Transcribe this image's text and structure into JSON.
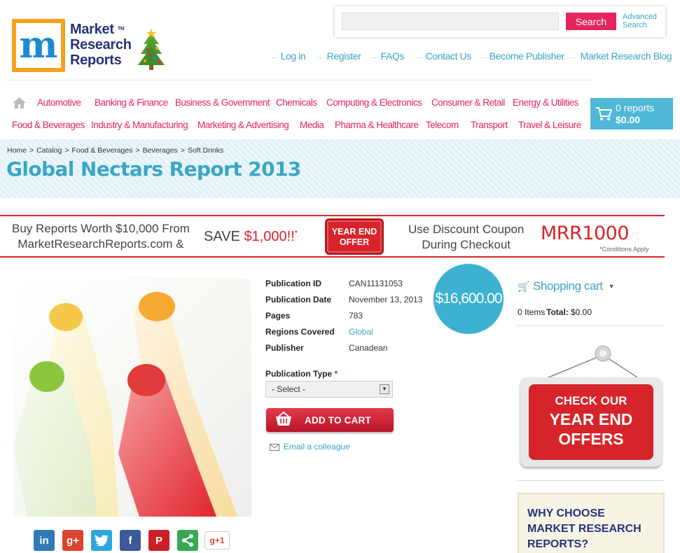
{
  "header": {
    "logo": {
      "line1": "Market",
      "line2": "Research",
      "line3": "Reports",
      "tm": "TM"
    },
    "search": {
      "placeholder": "",
      "button": "Search",
      "advanced": "Advanced Search"
    },
    "toplinks": [
      "Log in",
      "Register",
      "FAQs",
      "Contact Us",
      "Become Publisher",
      "Market Research Blog"
    ]
  },
  "nav": {
    "row1": [
      "Automotive",
      "Banking & Finance",
      "Business & Government",
      "Chemicals",
      "Computing & Electronics",
      "Consumer & Retail",
      "Energy & Utilities"
    ],
    "row2": [
      "Food & Beverages",
      "Industry & Manufacturing",
      "Marketing & Advertising",
      "Media",
      "Pharma & Healthcare",
      "Telecom",
      "Transport",
      "Travel & Leisure"
    ]
  },
  "cart_widget": {
    "count": "0 reports",
    "total": "$0.00"
  },
  "breadcrumb": [
    "Home",
    "Catalog",
    "Food & Beverages",
    "Beverages",
    "Soft Drinks"
  ],
  "page_title": "Global Nectars Report 2013",
  "promo": {
    "line1": "Buy Reports Worth $10,000 From",
    "line2": "MarketResearchReports.com &",
    "save": "SAVE",
    "amount": "$1,000!!",
    "asterisk": "*",
    "badge1": "YEAR END",
    "badge2": "OFFER",
    "coupon1": "Use Discount Coupon",
    "coupon2": "During Checkout",
    "code": "MRR1000",
    "conditions": "*Conditions Apply"
  },
  "product": {
    "fields": [
      {
        "label": "Publication ID",
        "value": "CAN11131053"
      },
      {
        "label": "Publication Date",
        "value": "November 13, 2013"
      },
      {
        "label": "Pages",
        "value": "783"
      },
      {
        "label": "Regions Covered",
        "value": "Global"
      },
      {
        "label": "Publisher",
        "value": "Canadean"
      }
    ],
    "price": "$16,600.00",
    "type_label": "Publication Type",
    "type_required": "*",
    "type_selected": "- Select -",
    "add_to_cart": "ADD TO CART",
    "email": "Email a colleague"
  },
  "social": {
    "gplus_one": "g+1"
  },
  "sidebar": {
    "cart_title": "Shopping cart",
    "items_text": "0 Items",
    "total_label": "Total:",
    "total_value": "$0.00",
    "offer_line1": "CHECK OUR",
    "offer_line2": "YEAR END",
    "offer_line3": "OFFERS",
    "why_line1": "WHY CHOOSE",
    "why_line2": "MARKET RESEARCH",
    "why_line3": "REPORTS?"
  },
  "colors": {
    "accent": "#e6245f",
    "link": "#3aa6c6",
    "promo_red": "#d7242b",
    "cart_blue": "#4eb8d6"
  }
}
